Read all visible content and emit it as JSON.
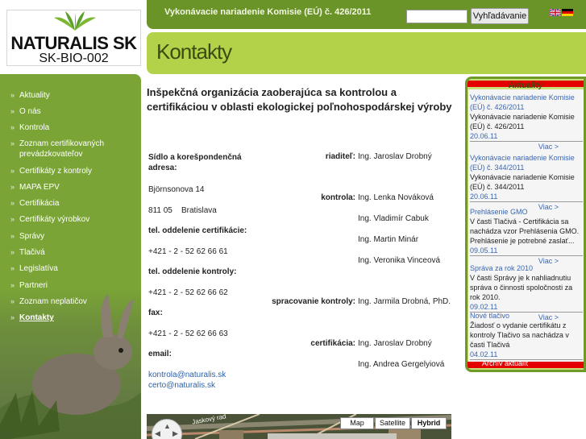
{
  "logo": {
    "brand": "NATURALIS SK",
    "code": "SK-BIO-002"
  },
  "header": {
    "headline": "Vykonávacie nariadenie Komisie (EÚ) č. 426/2011",
    "search": {
      "value": "",
      "placeholder": "",
      "button_label": "Vyhľadávanie"
    },
    "flags": [
      "flag-en-icon",
      "flag-de-icon"
    ]
  },
  "page_title": "Kontakty",
  "sidebar": {
    "items": [
      {
        "label": "Aktuality"
      },
      {
        "label": "O nás"
      },
      {
        "label": "Kontrola"
      },
      {
        "label": "Zoznam certifikovaných prevádzkovateľov"
      },
      {
        "label": "Certifikáty z kontroly"
      },
      {
        "label": "MAPA EPV"
      },
      {
        "label": "Certifikácia"
      },
      {
        "label": "Certifikáty výrobkov"
      },
      {
        "label": "Správy"
      },
      {
        "label": "Tlačivá"
      },
      {
        "label": "Legislatíva"
      },
      {
        "label": "Partneri"
      },
      {
        "label": "Zoznam neplatičov"
      },
      {
        "label": "Kontakty"
      }
    ],
    "active": "Kontakty"
  },
  "content": {
    "heading": "Inšpekčná organizácia zaoberajúca sa kontrolou a certifikáciou v oblasti ekologickej poľnohospodárskej výroby",
    "address_label": "Sídlo a korešpondenčná adresa:",
    "street": "Björnsonova 14",
    "city": "811 05    Bratislava",
    "tel_cert_label": "tel. oddelenie certifikácie:",
    "tel_cert": "+421 - 2 - 52 62 66 61",
    "tel_ctrl_label": "tel. oddelenie kontroly:",
    "tel_ctrl": "+421 - 2 - 52 62 66 62",
    "fax_label": "fax:",
    "fax": "+421 - 2 - 52 62 66 63",
    "email_label": "email:",
    "emails": [
      "kontrola@naturalis.sk",
      "certo@naturalis.sk"
    ],
    "staff": [
      {
        "role": "riaditeľ:",
        "names": [
          "Ing. Jaroslav Drobný"
        ]
      },
      {
        "role": "kontrola:",
        "names": [
          "Ing. Lenka Nováková",
          "Ing. Vladimír Cabuk",
          "Ing. Martin Minár",
          "Ing. Veronika Vinceová"
        ]
      },
      {
        "role": "spracovanie kontroly:",
        "names": [
          "Ing. Jarmila Drobná, PhD."
        ]
      },
      {
        "role": "certifikácia:",
        "names": [
          "Ing. Jaroslav Drobný",
          "Ing. Andrea Gergelyiová"
        ]
      }
    ]
  },
  "map": {
    "buttons": [
      "Map",
      "Satellite",
      "Hybrid"
    ],
    "selected": "Hybrid",
    "street_label": "Jaskový rad"
  },
  "news": {
    "heading": "Aktuality",
    "more_label": "Viac >",
    "items": [
      {
        "title": "Vykonávacie nariadenie Komisie (EÚ) č. 426/2011",
        "desc": "Vykonávacie nariadenie Komisie (EÚ) č. 426/2011",
        "date": "20.06.11"
      },
      {
        "title": "Vykonávacie nariadenie Komisie (EÚ) č. 344/2011",
        "desc": "Vykonávacie nariadenie Komisie (EÚ) č. 344/2011",
        "date": "20.06.11"
      },
      {
        "title": "Prehlásenie GMO",
        "desc": "V časti Tlačivá - Certifikácia sa nachádza vzor Prehlásenia GMO. Prehlásenie je potrebné zaslať...",
        "date": "09.05.11"
      },
      {
        "title": "Správa za rok 2010",
        "desc": "V časti Správy je k nahliadnutiu správa o činnosti spoločnosti za rok 2010.",
        "date": "09.02.11"
      },
      {
        "title": "Nové tlačivo",
        "desc": "Žiadosť o vydanie certifikátu z kontroly Tlačivo sa nachádza v časti Tlačivá",
        "date": "04.02.11"
      }
    ],
    "archive_label": "Archív aktualít"
  },
  "colors": {
    "green_dark": "#6a9428",
    "green_light": "#b3d24a",
    "sidebar": "#7aa536",
    "news_red": "#e50000",
    "link_blue": "#3a66b0"
  }
}
